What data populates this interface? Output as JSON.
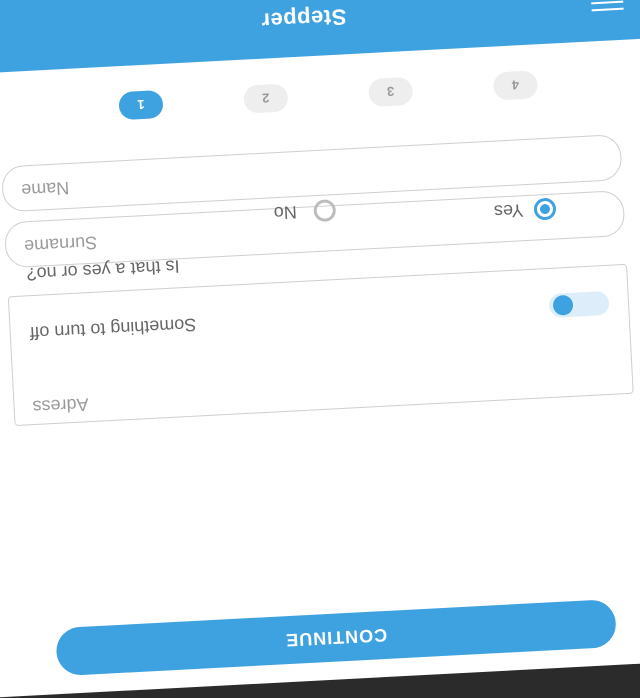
{
  "app": {
    "title": "Stepper",
    "menu_icon": "menu-icon",
    "accent_color": "#3fa2e0"
  },
  "steps": [
    {
      "label": "1",
      "active": true
    },
    {
      "label": "2",
      "active": false
    },
    {
      "label": "3",
      "active": false
    },
    {
      "label": "4",
      "active": false
    }
  ],
  "form": {
    "name_placeholder": "Name",
    "surname_placeholder": "Surname",
    "address_placeholder": "Adress",
    "toggle_label": "Something to turn off",
    "question": "Is that a yes or no?",
    "yes_label": "Yes",
    "no_label": "No",
    "selected": "Yes"
  },
  "footer": {
    "continue_label": "CONTINUE"
  }
}
